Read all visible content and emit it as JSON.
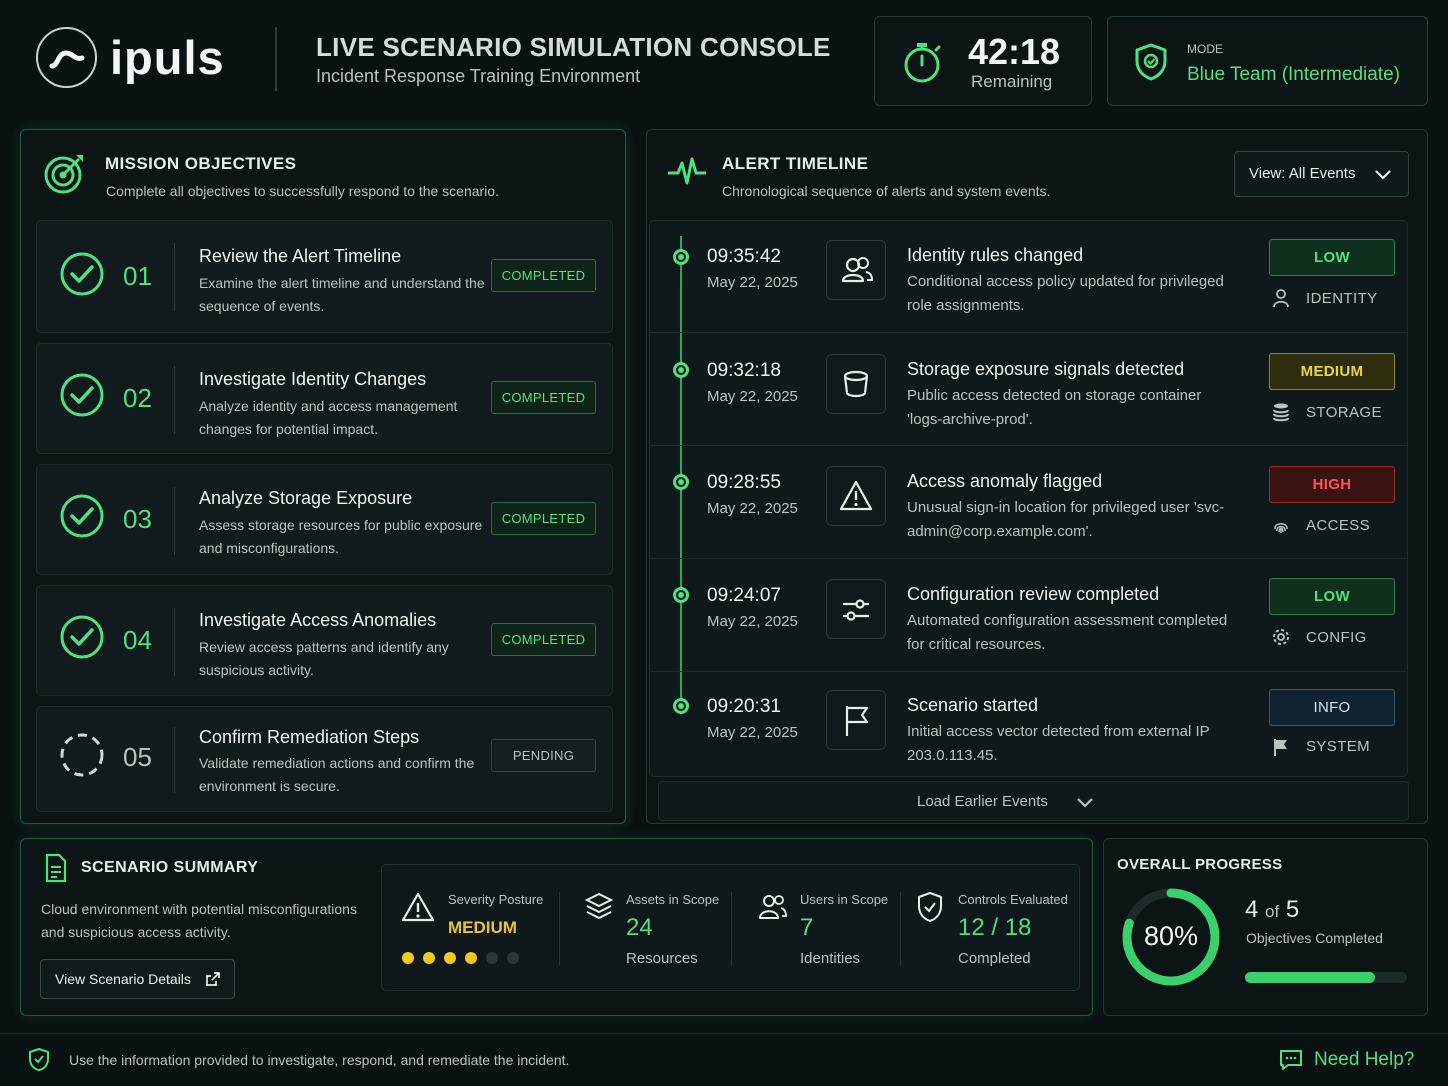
{
  "header": {
    "brand": "ipuls",
    "title": "LIVE SCENARIO SIMULATION CONSOLE",
    "subtitle": "Incident Response Training Environment",
    "timer_value": "42:18",
    "timer_label": "Remaining",
    "mode_label": "MODE",
    "mode_value": "Blue Team (Intermediate)"
  },
  "objectives": {
    "title": "MISSION OBJECTIVES",
    "subtitle": "Complete all objectives to successfully respond to the scenario.",
    "items": [
      {
        "num": "01",
        "title": "Review the Alert Timeline",
        "desc": "Examine the alert timeline and understand the sequence of events.",
        "status": "COMPLETED"
      },
      {
        "num": "02",
        "title": "Investigate Identity Changes",
        "desc": "Analyze identity and access management changes for potential impact.",
        "status": "COMPLETED"
      },
      {
        "num": "03",
        "title": "Analyze Storage Exposure",
        "desc": "Assess storage resources for public exposure and misconfigurations.",
        "status": "COMPLETED"
      },
      {
        "num": "04",
        "title": "Investigate Access Anomalies",
        "desc": "Review access patterns and identify any suspicious activity.",
        "status": "COMPLETED"
      },
      {
        "num": "05",
        "title": "Confirm Remediation Steps",
        "desc": "Validate remediation actions and confirm the environment is secure.",
        "status": "PENDING"
      }
    ]
  },
  "timeline": {
    "title": "ALERT TIMELINE",
    "subtitle": "Chronological sequence of alerts and system events.",
    "view_select": "View: All Events",
    "load_more": "Load Earlier Events",
    "events": [
      {
        "time": "09:35:42",
        "date": "May 22, 2025",
        "icon": "users-icon",
        "title": "Identity rules changed",
        "desc": "Conditional access policy updated for privileged role assignments.",
        "severity": "LOW",
        "category": "IDENTITY",
        "category_icon": "person-icon"
      },
      {
        "time": "09:32:18",
        "date": "May 22, 2025",
        "icon": "bucket-icon",
        "title": "Storage exposure signals detected",
        "desc": "Public access detected on storage container 'logs-archive-prod'.",
        "severity": "MEDIUM",
        "category": "STORAGE",
        "category_icon": "database-icon"
      },
      {
        "time": "09:28:55",
        "date": "May 22, 2025",
        "icon": "warning-icon",
        "title": "Access anomaly flagged",
        "desc": "Unusual sign-in location for privileged user 'svc-admin@corp.example.com'.",
        "severity": "HIGH",
        "category": "ACCESS",
        "category_icon": "fingerprint-icon"
      },
      {
        "time": "09:24:07",
        "date": "May 22, 2025",
        "icon": "sliders-icon",
        "title": "Configuration review completed",
        "desc": "Automated configuration assessment completed for critical resources.",
        "severity": "LOW",
        "category": "CONFIG",
        "category_icon": "gear-icon"
      },
      {
        "time": "09:20:31",
        "date": "May 22, 2025",
        "icon": "flag-icon",
        "title": "Scenario started",
        "desc": "Initial access vector detected from external IP 203.0.113.45.",
        "severity": "INFO",
        "category": "SYSTEM",
        "category_icon": "flag-icon"
      }
    ]
  },
  "summary": {
    "title": "SCENARIO SUMMARY",
    "desc": "Cloud environment with potential misconfigurations and suspicious access activity.",
    "details_button": "View Scenario Details",
    "severity_label": "Severity Posture",
    "severity_value": "MEDIUM",
    "severity_level": 4,
    "severity_max": 6,
    "assets_label": "Assets in Scope",
    "assets_value": "24",
    "assets_sub": "Resources",
    "users_label": "Users in Scope",
    "users_value": "7",
    "users_sub": "Identities",
    "controls_label": "Controls Evaluated",
    "controls_value": "12 / 18",
    "controls_sub": "Completed"
  },
  "progress": {
    "title": "OVERALL PROGRESS",
    "percent_text": "80%",
    "percent": 0.8,
    "count_a": "4",
    "count_of": "of",
    "count_b": "5",
    "label": "Objectives Completed"
  },
  "footer": {
    "message": "Use the information provided to investigate, respond, and remediate the incident.",
    "help": "Need Help?"
  },
  "colors": {
    "accent": "#4fe07f",
    "background": "#0a1113",
    "medium": "#e8d63d",
    "high": "#ff5353"
  }
}
